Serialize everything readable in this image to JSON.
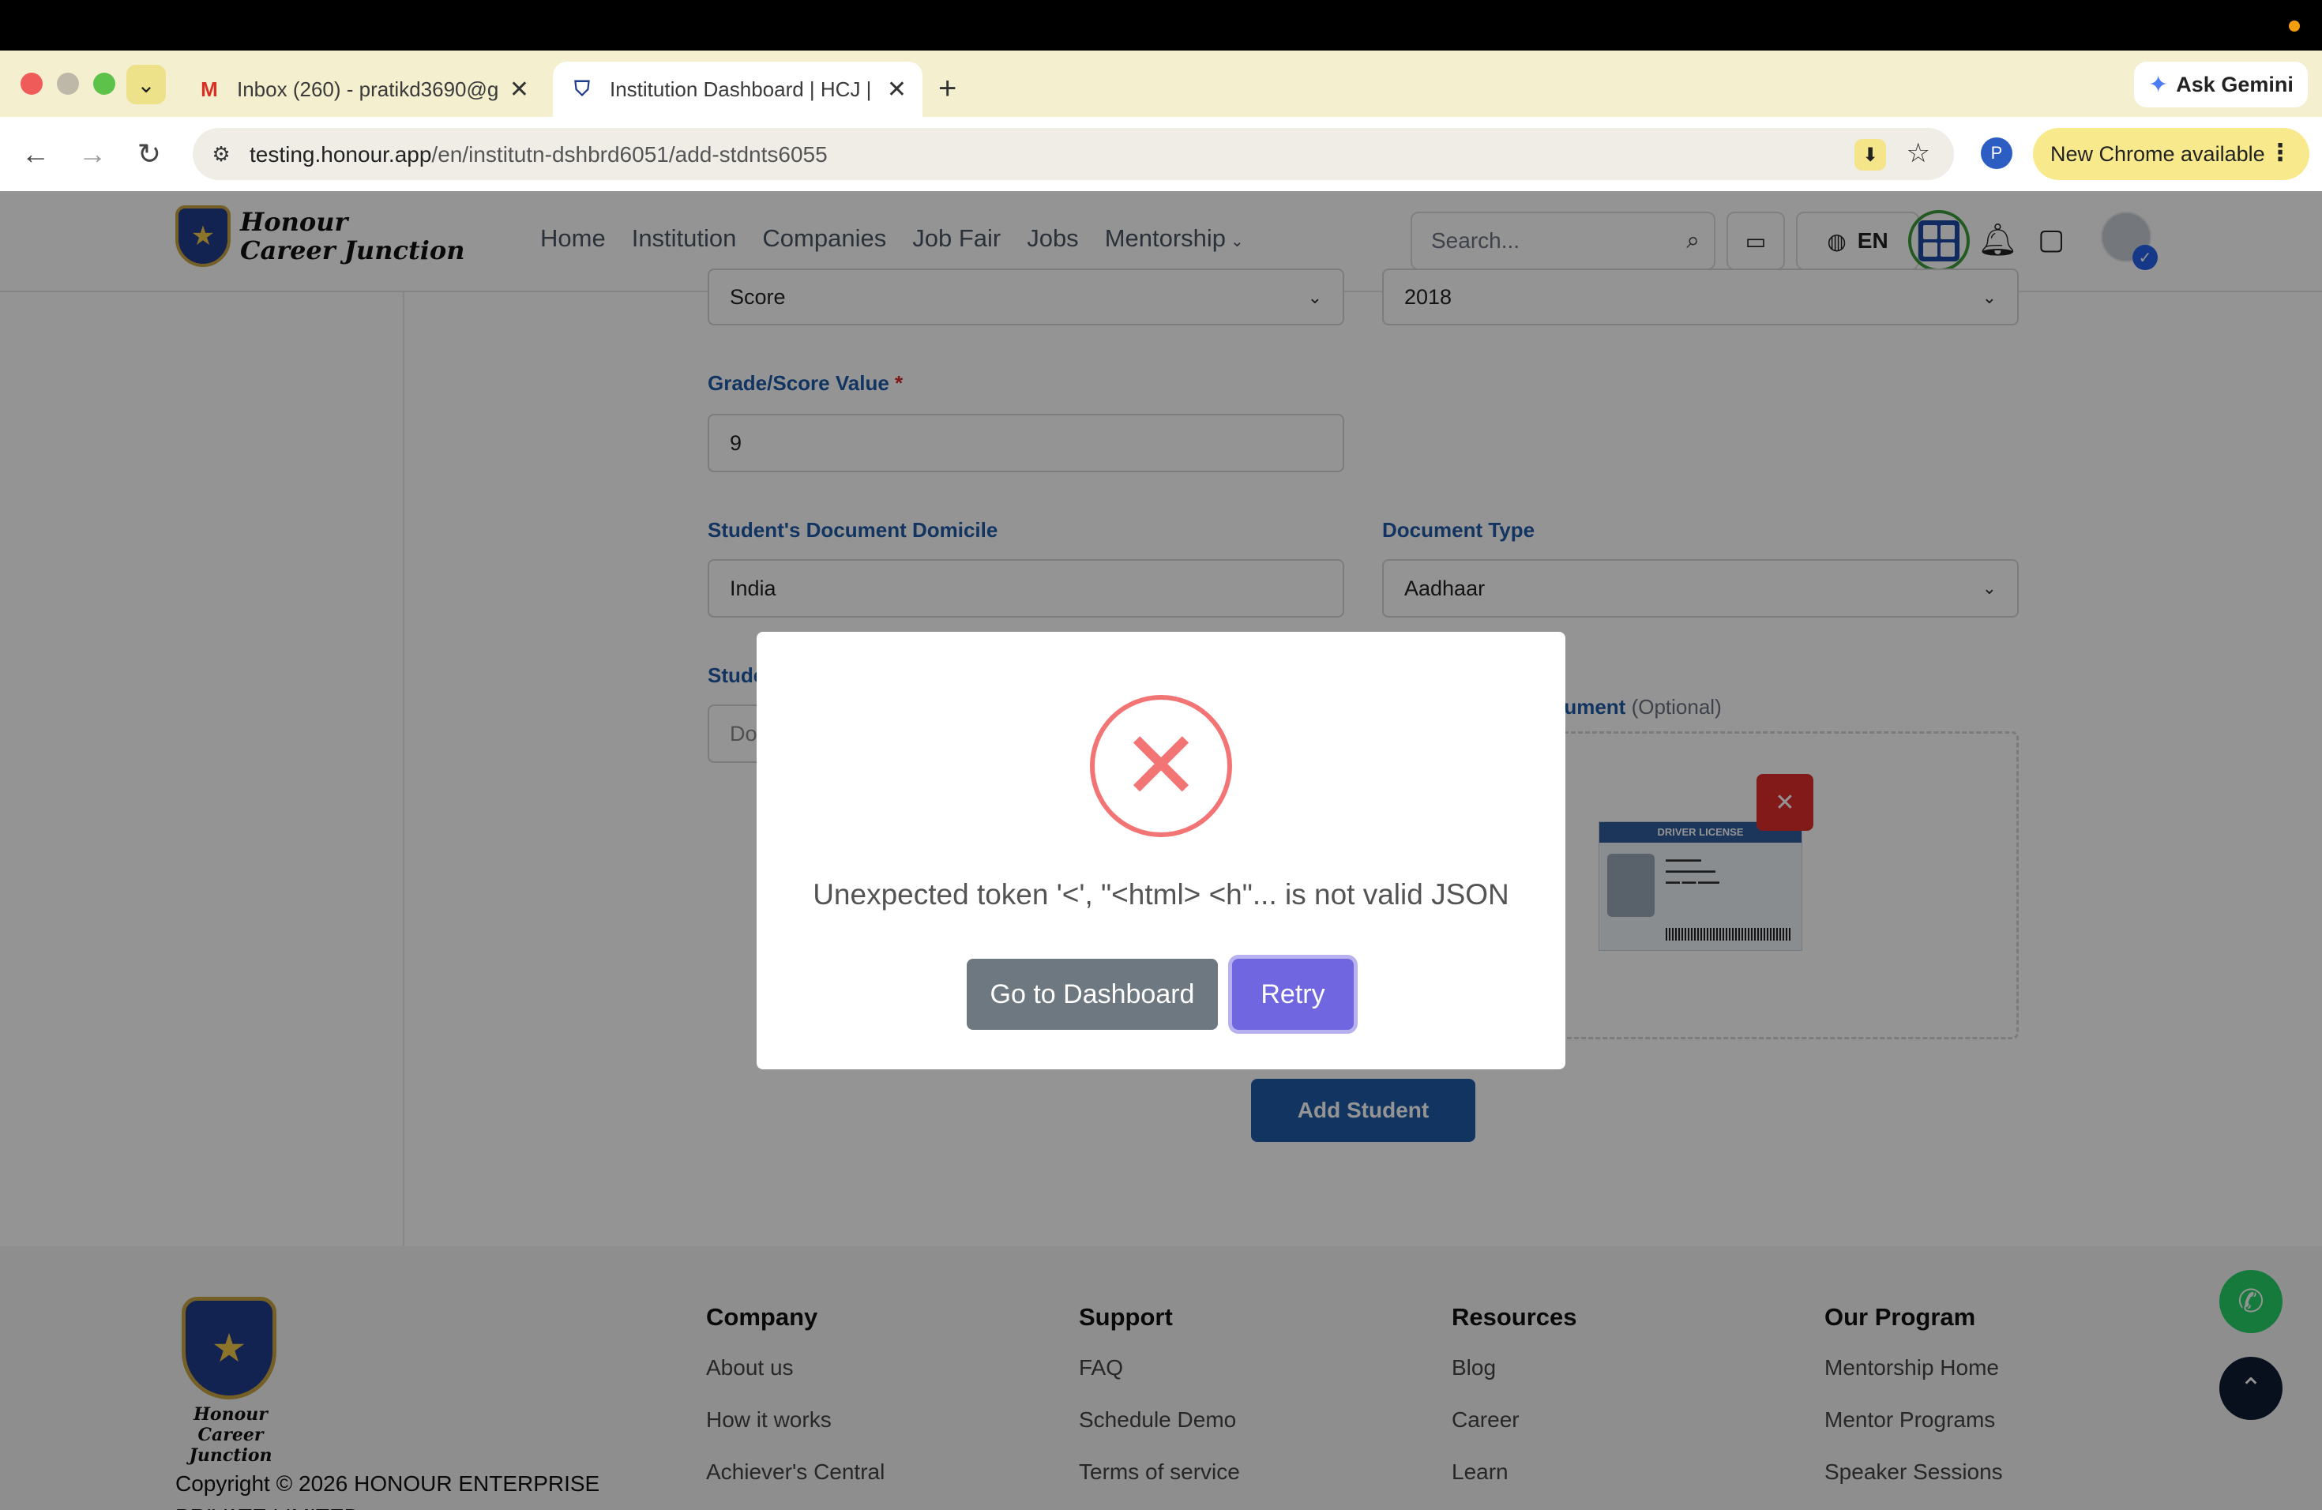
{
  "browser": {
    "tabs": [
      {
        "title": "Inbox (260) - pratikd3690@g",
        "favicon": "gmail-icon"
      },
      {
        "title": "Institution Dashboard | HCJ |",
        "favicon": "hcj-icon"
      }
    ],
    "url_host": "testing.honour.app",
    "url_path": "/en/institutn-dshbrd6051/add-stdnts6055",
    "ask_gemini": "Ask Gemini",
    "profile_initial": "P",
    "update_label": "New Chrome available"
  },
  "site": {
    "logo_line1": "Honour",
    "logo_line2": "Career Junction",
    "nav": [
      "Home",
      "Institution",
      "Companies",
      "Job Fair",
      "Jobs",
      "Mentorship"
    ],
    "search_placeholder": "Search...",
    "language": "EN"
  },
  "form": {
    "score_type": "Score",
    "year": "2018",
    "grade_label": "Grade/Score Value",
    "grade_required_mark": "*",
    "grade_value": "9",
    "domicile_label": "Student's Document Domicile",
    "domicile_value": "India",
    "doctype_label": "Document Type",
    "doctype_value": "Aadhaar",
    "doc_number_label_partial": "Stude",
    "doc_number_value_partial": "Do",
    "upload_label_partial": "ocument",
    "upload_optional": "(Optional)",
    "license_header": "DRIVER LICENSE",
    "add_student": "Add Student"
  },
  "footer": {
    "logo_line1": "Honour",
    "logo_line2": "Career Junction",
    "copyright_line1": "Copyright © 2026 HONOUR ENTERPRISE",
    "copyright_line2": "PRIVATE LIMITED",
    "columns": [
      {
        "title": "Company",
        "links": [
          "About us",
          "How it works",
          "Achiever's Central"
        ]
      },
      {
        "title": "Support",
        "links": [
          "FAQ",
          "Schedule Demo",
          "Terms of service"
        ]
      },
      {
        "title": "Resources",
        "links": [
          "Blog",
          "Career",
          "Learn"
        ]
      },
      {
        "title": "Our Program",
        "links": [
          "Mentorship Home",
          "Mentor Programs",
          "Speaker Sessions"
        ]
      }
    ]
  },
  "modal": {
    "message": "Unexpected token '<', \"<html> <h\"... is not valid JSON",
    "dashboard_button": "Go to Dashboard",
    "retry_button": "Retry"
  },
  "colors": {
    "primary": "#1e5aa8",
    "error": "#f27474",
    "retry": "#7066e0",
    "dashboard_btn": "#6e7881"
  }
}
